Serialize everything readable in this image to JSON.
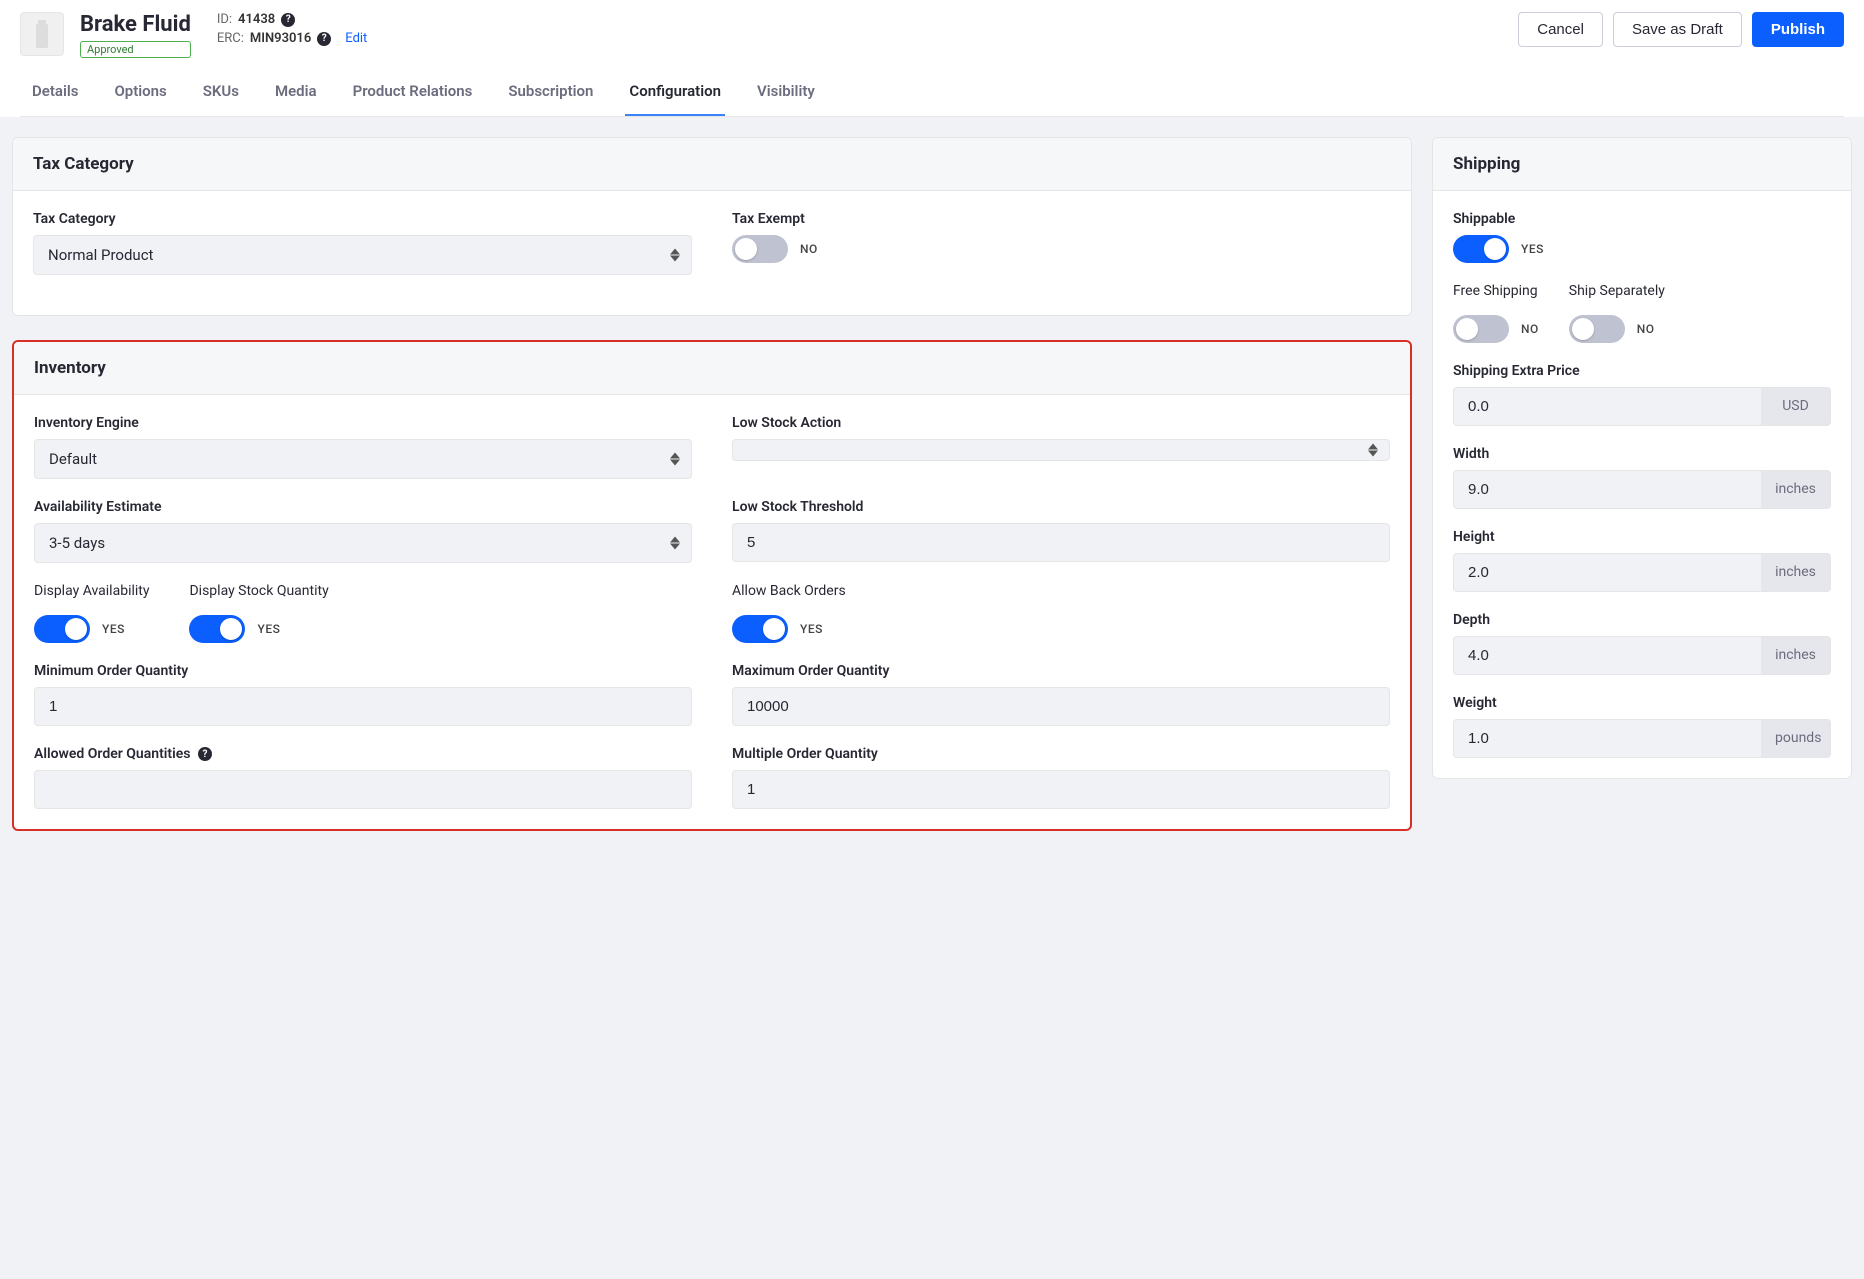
{
  "header": {
    "title": "Brake Fluid",
    "status_badge": "Approved",
    "id_label": "ID:",
    "id_value": "41438",
    "erc_label": "ERC:",
    "erc_value": "MIN93016",
    "edit_label": "Edit",
    "actions": {
      "cancel": "Cancel",
      "save_draft": "Save as Draft",
      "publish": "Publish"
    }
  },
  "tabs": [
    "Details",
    "Options",
    "SKUs",
    "Media",
    "Product Relations",
    "Subscription",
    "Configuration",
    "Visibility"
  ],
  "active_tab_index": 6,
  "tax": {
    "panel_title": "Tax Category",
    "category_label": "Tax Category",
    "category_value": "Normal Product",
    "exempt_label": "Tax Exempt",
    "exempt_on": false,
    "exempt_text": "NO"
  },
  "inventory": {
    "panel_title": "Inventory",
    "engine_label": "Inventory Engine",
    "engine_value": "Default",
    "low_stock_action_label": "Low Stock Action",
    "low_stock_action_value": "",
    "availability_label": "Availability Estimate",
    "availability_value": "3-5 days",
    "low_stock_threshold_label": "Low Stock Threshold",
    "low_stock_threshold_value": "5",
    "display_availability_label": "Display Availability",
    "display_availability_on": true,
    "display_availability_text": "YES",
    "display_stock_qty_label": "Display Stock Quantity",
    "display_stock_qty_on": true,
    "display_stock_qty_text": "YES",
    "allow_backorders_label": "Allow Back Orders",
    "allow_backorders_on": true,
    "allow_backorders_text": "YES",
    "min_qty_label": "Minimum Order Quantity",
    "min_qty_value": "1",
    "max_qty_label": "Maximum Order Quantity",
    "max_qty_value": "10000",
    "allowed_qty_label": "Allowed Order Quantities",
    "allowed_qty_value": "",
    "multiple_qty_label": "Multiple Order Quantity",
    "multiple_qty_value": "1"
  },
  "shipping": {
    "panel_title": "Shipping",
    "shippable_label": "Shippable",
    "shippable_on": true,
    "shippable_text": "YES",
    "free_shipping_label": "Free Shipping",
    "free_shipping_on": false,
    "free_shipping_text": "NO",
    "ship_separately_label": "Ship Separately",
    "ship_separately_on": false,
    "ship_separately_text": "NO",
    "extra_price_label": "Shipping Extra Price",
    "extra_price_value": "0.0",
    "extra_price_unit": "USD",
    "width_label": "Width",
    "width_value": "9.0",
    "width_unit": "inches",
    "height_label": "Height",
    "height_value": "2.0",
    "height_unit": "inches",
    "depth_label": "Depth",
    "depth_value": "4.0",
    "depth_unit": "inches",
    "weight_label": "Weight",
    "weight_value": "1.0",
    "weight_unit": "pounds"
  }
}
